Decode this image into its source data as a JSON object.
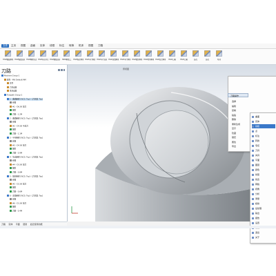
{
  "menu": {
    "items": [
      {
        "label": "文件",
        "active": true
      },
      {
        "label": "主页",
        "active": false
      },
      {
        "label": "视图",
        "active": false
      },
      {
        "label": "曲面",
        "active": false
      },
      {
        "label": "实体",
        "active": false
      },
      {
        "label": "线框",
        "active": false
      },
      {
        "label": "标注",
        "active": false
      },
      {
        "label": "转换",
        "active": false
      },
      {
        "label": "机床",
        "active": false
      },
      {
        "label": "视图",
        "active": false
      },
      {
        "label": "刀路",
        "active": false
      }
    ]
  },
  "ribbon": {
    "buttons": [
      "HSM曲面精修",
      "HSM偏置铣削",
      "HSM精修高度",
      "HSM等高环绕",
      "HSM螺旋铣削",
      "HSM精加工",
      "HSM投影精修",
      "HSM平行精加工",
      "HSM平行铣削",
      "HSM流线精修",
      "HSM平行精修",
      "HSM放射精修",
      "HSM径向精修",
      "HSM混合精修",
      "HSM刀路",
      "HSM刀路",
      "钻孔",
      "钻孔",
      "毛坯"
    ]
  },
  "panel": {
    "title": "刀路",
    "tree": [
      {
        "text": "Machine Group-1",
        "depth": 0,
        "color": "#3a78c9"
      },
      {
        "text": "属性 - Mill Default MM",
        "depth": 1,
        "color": "#c98a2b"
      },
      {
        "text": "文件",
        "depth": 2,
        "color": "#c98a2b"
      },
      {
        "text": "刀具设置",
        "depth": 2,
        "color": "#c98a2b"
      },
      {
        "text": "毛坯设置",
        "depth": 2,
        "color": "#c98a2b"
      },
      {
        "text": "Toolpath Group-1",
        "depth": 1,
        "color": "#3a78c9"
      },
      {
        "text": "1 - 曲面精修 [WCS: Top] - [刀具面: Top]",
        "depth": 2,
        "color": "#3a78c9",
        "sel": true
      },
      {
        "text": "参数",
        "depth": 3,
        "color": "#888"
      },
      {
        "text": "#1 - D6.00 球刀",
        "depth": 3,
        "color": "#c98a2b"
      },
      {
        "text": "图形",
        "depth": 3,
        "color": "#2b9a4a"
      },
      {
        "text": "刀路 - 1.2M",
        "depth": 3,
        "color": "#2b9a4a"
      },
      {
        "text": "2 - 曲面精修 [WCS: Top] - [刀具面: Top]",
        "depth": 2,
        "color": "#3a78c9"
      },
      {
        "text": "参数",
        "depth": 3,
        "color": "#888"
      },
      {
        "text": "#2 - D4.00 平底刀",
        "depth": 3,
        "color": "#c98a2b"
      },
      {
        "text": "图形",
        "depth": 3,
        "color": "#2b9a4a"
      },
      {
        "text": "刀路 - 1.1M",
        "depth": 3,
        "color": "#2b9a4a"
      },
      {
        "text": "3 - 平行精修 [WCS: Top] - [刀具面: Top]",
        "depth": 2,
        "color": "#3a78c9"
      },
      {
        "text": "参数",
        "depth": 3,
        "color": "#888"
      },
      {
        "text": "#3 - D4.00 球刀",
        "depth": 3,
        "color": "#c98a2b"
      },
      {
        "text": "图形",
        "depth": 3,
        "color": "#2b9a4a"
      },
      {
        "text": "刀路 - 0.9M",
        "depth": 3,
        "color": "#2b9a4a"
      },
      {
        "text": "4 - 等高精修 [WCS: Top] - [刀具面: Top]",
        "depth": 2,
        "color": "#3a78c9"
      },
      {
        "text": "参数",
        "depth": 3,
        "color": "#888"
      },
      {
        "text": "#4 - D3.00 球刀",
        "depth": 3,
        "color": "#c98a2b"
      },
      {
        "text": "图形",
        "depth": 3,
        "color": "#2b9a4a"
      },
      {
        "text": "刀路 - 0.8M",
        "depth": 3,
        "color": "#2b9a4a"
      },
      {
        "text": "5 - 放射精修 [WCS: Top] - [刀具面: Top]",
        "depth": 2,
        "color": "#3a78c9"
      },
      {
        "text": "参数",
        "depth": 3,
        "color": "#888"
      },
      {
        "text": "#5 - D2.00 球刀",
        "depth": 3,
        "color": "#c98a2b"
      },
      {
        "text": "图形",
        "depth": 3,
        "color": "#2b9a4a"
      },
      {
        "text": "刀路 - 0.6M",
        "depth": 3,
        "color": "#2b9a4a"
      },
      {
        "text": "6 - 清角精修 [WCS: Top] - [刀具面: Top]",
        "depth": 2,
        "color": "#3a78c9"
      },
      {
        "text": "参数",
        "depth": 3,
        "color": "#888"
      },
      {
        "text": "#6 - D1.00 球刀",
        "depth": 3,
        "color": "#c98a2b"
      },
      {
        "text": "图形",
        "depth": 3,
        "color": "#2b9a4a"
      },
      {
        "text": "刀路 - 0.4M",
        "depth": 3,
        "color": "#2b9a4a"
      }
    ]
  },
  "viewport": {
    "title": "俯视图"
  },
  "context_menu": {
    "header": "刀路操作",
    "items": [
      "选择",
      "编辑",
      "复制",
      "粘贴",
      "删除",
      "重新生成",
      "显示",
      "隐藏",
      "锁定",
      "属性",
      "导出"
    ]
  },
  "submenu": {
    "items": [
      {
        "label": "曲面",
        "hl": false
      },
      {
        "label": "实体",
        "hl": false
      },
      {
        "label": "线框",
        "hl": true
      },
      {
        "label": "点",
        "hl": false
      },
      {
        "label": "标注",
        "hl": false
      },
      {
        "label": "转换",
        "hl": false
      },
      {
        "label": "毛坯",
        "hl": false
      },
      {
        "label": "刀具",
        "hl": false
      },
      {
        "label": "夹具",
        "hl": false
      },
      {
        "label": "平面",
        "hl": false
      },
      {
        "label": "图层",
        "hl": false
      },
      {
        "label": "颜色",
        "hl": false
      },
      {
        "label": "线型",
        "hl": false
      },
      {
        "label": "线宽",
        "hl": false
      },
      {
        "label": "网格",
        "hl": false
      },
      {
        "label": "视角",
        "hl": false
      },
      {
        "label": "分析",
        "hl": false
      },
      {
        "label": "测量",
        "hl": false
      },
      {
        "label": "模拟",
        "hl": false
      },
      {
        "label": "后处理",
        "hl": false
      },
      {
        "label": "输出",
        "hl": false
      },
      {
        "label": "报告",
        "hl": false
      },
      {
        "label": "设置",
        "hl": false
      },
      {
        "label": "帮助",
        "hl": false
      },
      {
        "label": "退出",
        "hl": false
      },
      {
        "label": "关于",
        "hl": false
      }
    ]
  },
  "tabs": [
    "刀路",
    "实体",
    "平面",
    "层别",
    "最近使用功能"
  ],
  "colors": {
    "accent": "#2b6fbf",
    "panel_border": "#b9c4d1",
    "model_gray": "#b7bcc2"
  }
}
